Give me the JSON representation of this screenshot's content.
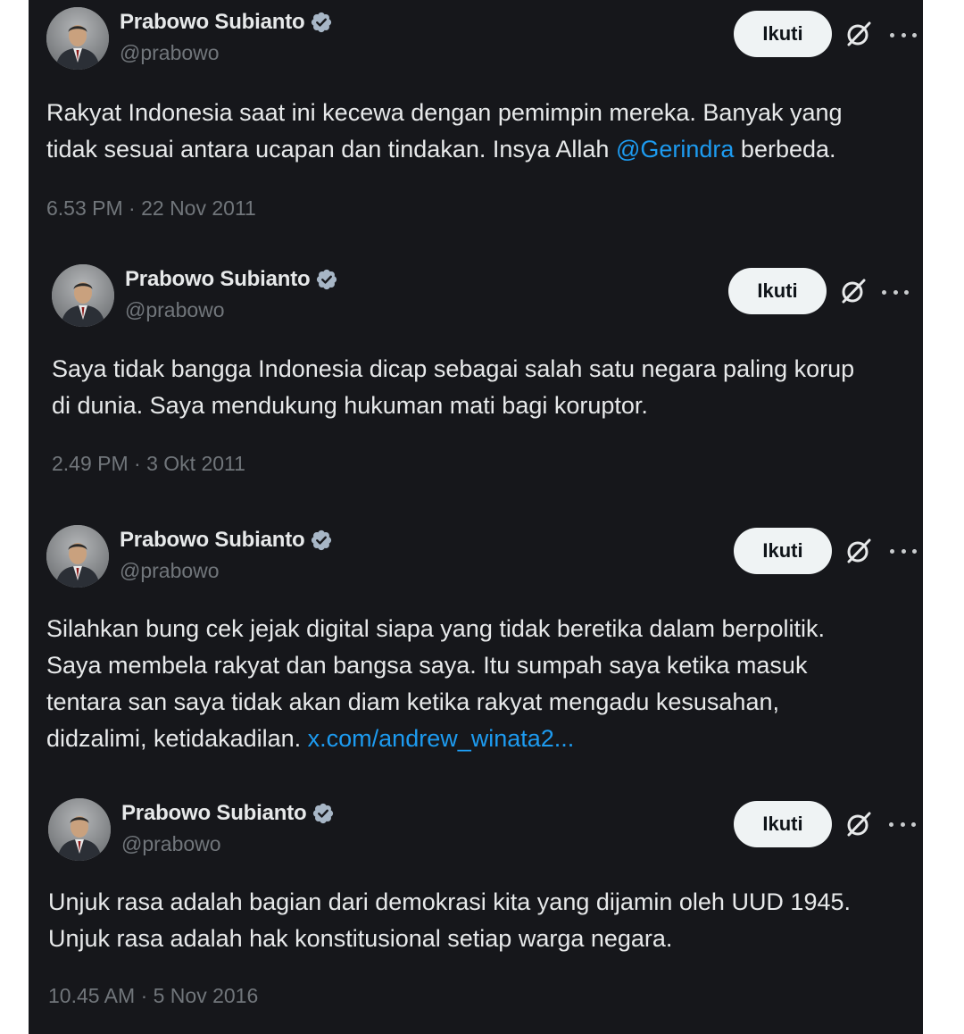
{
  "tweets": [
    {
      "display_name": "Prabowo Subianto",
      "handle": "@prabowo",
      "follow_label": "Ikuti",
      "icons": [
        "verified-badge-icon",
        "grok-icon",
        "more-options-icon"
      ],
      "lines": [
        [
          "Rakyat Indonesia saat ini kecewa dengan pemimpin mereka. Banyak yang"
        ],
        [
          "tidak sesuai antara ucapan dan tindakan. Insya Allah ",
          "@Gerindra",
          " berbeda."
        ]
      ],
      "timestamp": "6.53 PM · 22 Nov 2011"
    },
    {
      "display_name": "Prabowo Subianto",
      "handle": "@prabowo",
      "follow_label": "Ikuti",
      "lines": [
        [
          "Saya tidak bangga Indonesia dicap sebagai salah satu negara paling korup"
        ],
        [
          "di dunia. Saya mendukung hukuman mati bagi koruptor."
        ]
      ],
      "timestamp": "2.49 PM · 3 Okt 2011"
    },
    {
      "display_name": "Prabowo Subianto",
      "handle": "@prabowo",
      "follow_label": "Ikuti",
      "lines": [
        [
          "Silahkan bung cek jejak digital siapa yang tidak beretika dalam berpolitik."
        ],
        [
          "Saya membela rakyat dan bangsa saya. Itu sumpah saya ketika masuk"
        ],
        [
          "tentara san saya tidak akan diam ketika rakyat mengadu kesusahan,"
        ],
        [
          "didzalimi, ketidakadilan. ",
          "x.com/andrew_winata2..."
        ]
      ]
    },
    {
      "display_name": "Prabowo Subianto",
      "handle": "@prabowo",
      "follow_label": "Ikuti",
      "lines": [
        [
          "Unjuk rasa adalah bagian dari demokrasi kita yang dijamin oleh UUD 1945."
        ],
        [
          "Unjuk rasa adalah hak konstitusional setiap warga negara."
        ]
      ],
      "timestamp": "10.45 AM · 5 Nov 2016"
    }
  ],
  "colors": {
    "background": "#16171b",
    "text": "#e7e9ea",
    "muted": "#71767b",
    "link": "#1d9bf0",
    "verified": "#a7b6c6",
    "follow_button": "#eff3f4"
  }
}
